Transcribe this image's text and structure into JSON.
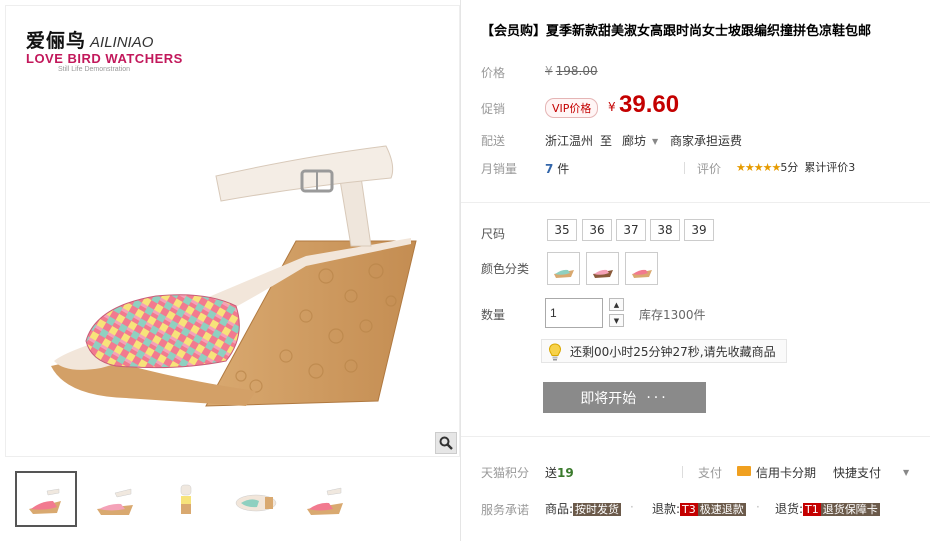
{
  "brand": {
    "name_cn": "爱俪鸟",
    "name_en": "AILINIAO",
    "slogan": "LOVE BIRD WATCHERS",
    "tagline": "Still Life Demonstration"
  },
  "product": {
    "title": "【会员购】夏季新款甜美淑女高跟时尚女士坡跟编织撞拼色凉鞋包邮"
  },
  "price": {
    "label": "价格",
    "currency": "¥",
    "original": "198.00"
  },
  "promo": {
    "label": "促销",
    "vip_tag": "VIP价格",
    "currency": "¥",
    "price": "39.60"
  },
  "shipping": {
    "label": "配送",
    "from": "浙江温州",
    "to_word": "至",
    "to": "廊坊",
    "fee_note": "商家承担运费"
  },
  "sales": {
    "label": "月销量",
    "count": "7",
    "unit": "件",
    "rating_label": "评价",
    "stars": "★★★★★",
    "score": "5分",
    "review_count_text": "累计评价3"
  },
  "options": {
    "size_label": "尺码",
    "sizes": [
      "35",
      "36",
      "37",
      "38",
      "39"
    ],
    "color_label": "颜色分类",
    "quantity_label": "数量",
    "quantity_value": "1",
    "stock_text": "库存1300件"
  },
  "countdown": {
    "text": "还剩00小时25分钟27秒,请先收藏商品"
  },
  "buy": {
    "button_label": "即将开始",
    "dots": "···"
  },
  "points": {
    "label": "天猫积分",
    "prefix": "送",
    "value": "19",
    "pay_label": "支付",
    "card_text": "信用卡分期",
    "quick_pay": "快捷支付"
  },
  "service": {
    "label": "服务承诺",
    "goods_prefix": "商品:",
    "goods_tag": "按时发货",
    "refund_prefix": "退款:",
    "refund_t3": "T3",
    "refund_tag": "极速退款",
    "return_prefix": "退货:",
    "return_t1": "T1",
    "return_tag": "退货保障卡"
  },
  "colors": {
    "price_red": "#c40000",
    "button_gray": "#8a8a8a",
    "brand_pink": "#c2185b",
    "link_blue": "#3366aa",
    "points_green": "#3a7a2c",
    "star_orange": "#e69b00"
  },
  "icons": {
    "zoom": "magnifier-icon",
    "bulb": "lightbulb-icon",
    "card": "credit-card-icon"
  }
}
